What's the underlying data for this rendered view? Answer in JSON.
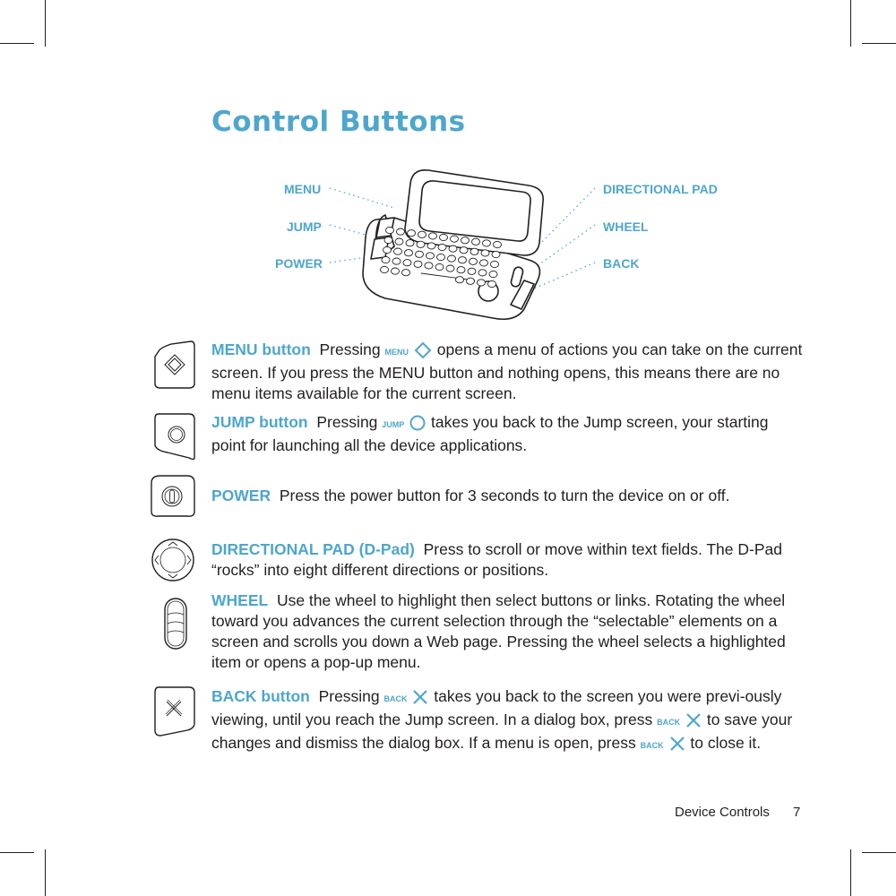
{
  "page": {
    "title": "Control Buttons",
    "accent_color": "#4ea6cc",
    "footer": {
      "section": "Device Controls",
      "page_number": "7"
    }
  },
  "diagram": {
    "callouts_left": [
      "MENU",
      "JUMP",
      "POWER"
    ],
    "callouts_right": [
      "DIRECTIONAL PAD",
      "WHEEL",
      "BACK"
    ]
  },
  "entries": [
    {
      "icon": "menu-diamond-icon",
      "keyword": "MENU button",
      "parts": [
        "Pressing ",
        "MENU",
        " opens a menu of actions you can take on the current screen. If you press the MENU button and nothing opens, this means there are no menu items available for the current screen."
      ]
    },
    {
      "icon": "jump-circle-icon",
      "keyword": "JUMP button",
      "parts": [
        "Pressing ",
        "JUMP",
        " takes you back to the Jump screen, your starting point for launching all the device applications."
      ]
    },
    {
      "icon": "power-icon",
      "keyword": "POWER",
      "parts": [
        "Press the power button for 3 seconds to turn the device on or off."
      ]
    },
    {
      "icon": "dpad-icon",
      "keyword": "DIRECTIONAL PAD (D-Pad)",
      "parts": [
        "Press to scroll or move within text fields. The D-Pad “rocks” into eight different directions or positions."
      ]
    },
    {
      "icon": "wheel-icon",
      "keyword": "WHEEL",
      "parts": [
        "Use the wheel to highlight then select buttons or links. Rotating the wheel toward you advances the current selection through the “selectable” elements on a screen and scrolls you down a Web page. Pressing the wheel selects a highlighted item or opens a pop-up menu."
      ]
    },
    {
      "icon": "back-x-icon",
      "keyword": "BACK button",
      "parts": [
        "Pressing ",
        "BACK",
        " takes you back to the screen you were previ-ously viewing, until you reach the Jump screen. In a dialog box, press ",
        "BACK",
        " to save your changes and dismiss the dialog box. If a menu is open, press ",
        "BACK",
        " to close it."
      ]
    }
  ]
}
